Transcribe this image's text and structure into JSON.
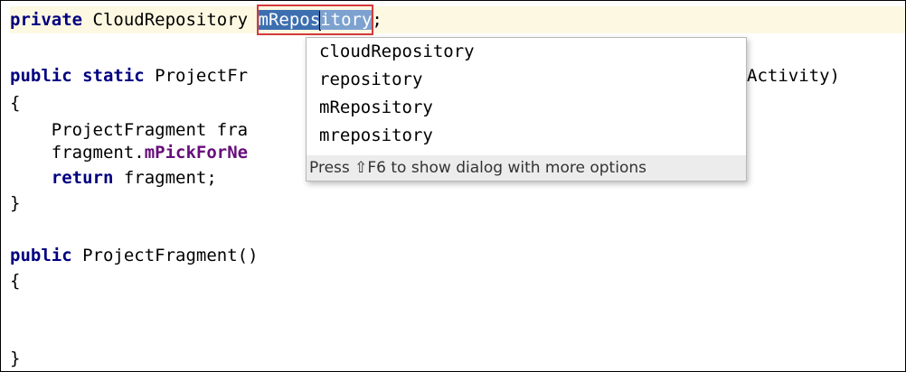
{
  "code": {
    "line1": {
      "kw": "private",
      "type": " CloudRepository ",
      "sel_a": "mRepos",
      "sel_b": "itory",
      "tail": ";"
    },
    "line3": {
      "kw": "public static",
      "text_a": " ProjectFr",
      "text_b": "Activity)"
    },
    "line4": "{",
    "line5": "    ProjectFragment fra",
    "line6": {
      "pre": "    fragment.",
      "field": "mPickForNe"
    },
    "line7": {
      "indent": "    ",
      "kw": "return",
      "rest": " fragment;"
    },
    "line8": "}",
    "line10": {
      "kw": "public",
      "rest": " ProjectFragment()"
    },
    "line11": "{",
    "line14": "}"
  },
  "popup": {
    "suggestions": [
      "cloudRepository",
      "repository",
      "mRepository",
      "mrepository"
    ],
    "hint": "Press ⇧F6 to show dialog with more options"
  }
}
